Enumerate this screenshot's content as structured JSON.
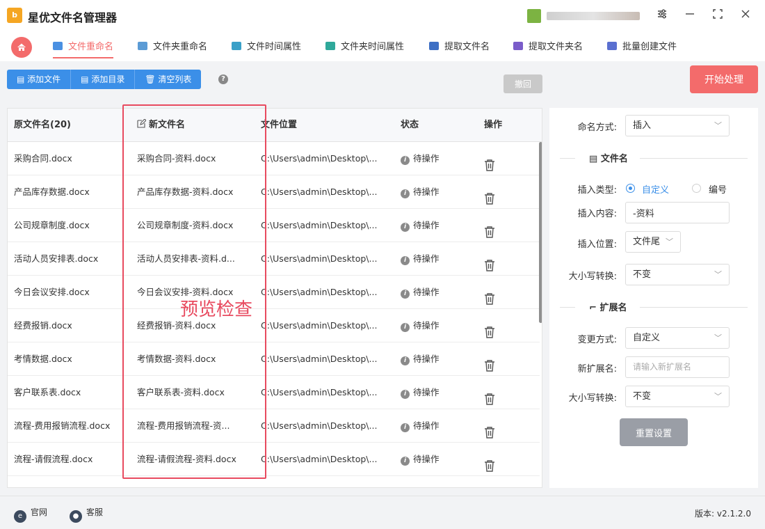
{
  "app": {
    "title": "星优文件名管理器",
    "logo_text": "b",
    "window_controls": [
      "settings-icon",
      "minimize-icon",
      "maximize-icon",
      "close-icon"
    ]
  },
  "tabs": [
    {
      "label": "文件重命名",
      "icon": "file-rename-icon",
      "color": "#4a90e2",
      "active": true
    },
    {
      "label": "文件夹重命名",
      "icon": "folder-rename-icon",
      "color": "#5b9bd5",
      "active": false
    },
    {
      "label": "文件时间属性",
      "icon": "file-time-icon",
      "color": "#3aa0c8",
      "active": false
    },
    {
      "label": "文件夹时间属性",
      "icon": "folder-time-icon",
      "color": "#2fa89a",
      "active": false
    },
    {
      "label": "提取文件名",
      "icon": "extract-file-icon",
      "color": "#3d6fc4",
      "active": false
    },
    {
      "label": "提取文件夹名",
      "icon": "extract-folder-icon",
      "color": "#7a5cc9",
      "active": false
    },
    {
      "label": "批量创建文件",
      "icon": "batch-create-icon",
      "color": "#5a6fd0",
      "active": false
    }
  ],
  "toolbar": {
    "add_file": "添加文件",
    "add_dir": "添加目录",
    "clear_list": "清空列表",
    "help": "?",
    "undo": "撤回",
    "start": "开始处理"
  },
  "table": {
    "headers": {
      "original": "原文件名(20)",
      "new": "新文件名",
      "path": "文件位置",
      "status": "状态",
      "action": "操作"
    },
    "rows": [
      {
        "original": "采购合同.docx",
        "new": "采购合同-资料.docx",
        "path": "C:\\Users\\admin\\Desktop\\...",
        "status": "待操作"
      },
      {
        "original": "产品库存数据.docx",
        "new": "产品库存数据-资料.docx",
        "path": "C:\\Users\\admin\\Desktop\\...",
        "status": "待操作"
      },
      {
        "original": "公司规章制度.docx",
        "new": "公司规章制度-资料.docx",
        "path": "C:\\Users\\admin\\Desktop\\...",
        "status": "待操作"
      },
      {
        "original": "活动人员安排表.docx",
        "new": "活动人员安排表-资料.d...",
        "path": "C:\\Users\\admin\\Desktop\\...",
        "status": "待操作"
      },
      {
        "original": "今日会议安排.docx",
        "new": "今日会议安排-资料.docx",
        "path": "C:\\Users\\admin\\Desktop\\...",
        "status": "待操作"
      },
      {
        "original": "经费报销.docx",
        "new": "经费报销-资料.docx",
        "path": "C:\\Users\\admin\\Desktop\\...",
        "status": "待操作"
      },
      {
        "original": "考情数据.docx",
        "new": "考情数据-资料.docx",
        "path": "C:\\Users\\admin\\Desktop\\...",
        "status": "待操作"
      },
      {
        "original": "客户联系表.docx",
        "new": "客户联系表-资料.docx",
        "path": "C:\\Users\\admin\\Desktop\\...",
        "status": "待操作"
      },
      {
        "original": "流程-费用报销流程.docx",
        "new": "流程-费用报销流程-资...",
        "path": "C:\\Users\\admin\\Desktop\\...",
        "status": "待操作"
      },
      {
        "original": "流程-请假流程.docx",
        "new": "流程-请假流程-资料.docx",
        "path": "C:\\Users\\admin\\Desktop\\...",
        "status": "待操作"
      }
    ]
  },
  "overlay": {
    "label": "预览检查",
    "color": "#e84a5f"
  },
  "panel": {
    "naming_mode_label": "命名方式:",
    "naming_mode_value": "插入",
    "filename_section": "文件名",
    "insert_type_label": "插入类型:",
    "insert_type_options": [
      "自定义",
      "编号"
    ],
    "insert_type_selected": "自定义",
    "insert_content_label": "插入内容:",
    "insert_content_value": "-资料",
    "insert_pos_label": "插入位置:",
    "insert_pos_value": "文件尾",
    "case_label": "大小写转换:",
    "case_value": "不变",
    "ext_section": "扩展名",
    "change_mode_label": "变更方式:",
    "change_mode_value": "自定义",
    "new_ext_label": "新扩展名:",
    "new_ext_placeholder": "请输入新扩展名",
    "ext_case_label": "大小写转换:",
    "ext_case_value": "不变",
    "reset": "重置设置"
  },
  "footer": {
    "website": "官网",
    "support": "客服",
    "version": "版本: v2.1.2.0"
  },
  "colors": {
    "accent": "#f36b6b",
    "primary": "#3b8fe8",
    "highlight": "#e84a5f"
  }
}
